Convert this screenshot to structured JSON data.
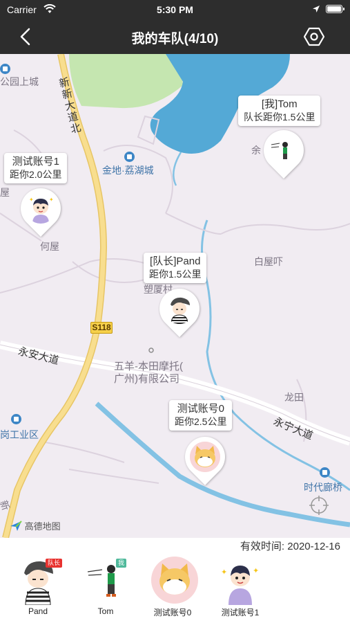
{
  "status_bar": {
    "carrier": "Carrier",
    "time": "5:30 PM"
  },
  "nav": {
    "title": "我的车队(4/10)"
  },
  "map": {
    "place_labels": {
      "park": "公园上城",
      "jindi": "金地·荔湖城",
      "hewu": "何屋",
      "wu": "屋",
      "baiwu": "白屋吓",
      "suliao": "塑厦村",
      "yu": "余",
      "longtian": "龙田",
      "wuyang": "五羊-本田摩托(",
      "wuyang2": "广州)有限公司",
      "gang": "岗工业区",
      "shidai": "时代廊桥",
      "xin": "新"
    },
    "road_labels": {
      "xinxin": "新新大道北",
      "yongan": "永安大道",
      "yongning": "永宁大道",
      "s118": "S118"
    },
    "provider": "高德地图",
    "markers": [
      {
        "line1": "测试账号1",
        "line2": "距你2.0公里"
      },
      {
        "line1": "[我]Tom",
        "line2": "队长距你1.5公里"
      },
      {
        "line1": "[队长]Pand",
        "line2": "距你1.5公里"
      },
      {
        "line1": "测试账号0",
        "line2": "距你2.5公里"
      }
    ]
  },
  "valid_until": "有效时间: 2020-12-16",
  "members": [
    {
      "name": "Pand",
      "badge": "队长"
    },
    {
      "name": "Tom",
      "badge": "我"
    },
    {
      "name": "测试账号0"
    },
    {
      "name": "测试账号1"
    }
  ],
  "colors": {
    "nav_bg": "#2d2d2d",
    "map_bg": "#f1ecf2",
    "water": "#54a9d6",
    "road_main": "#f6d87a",
    "badge_leader": "#e8322f",
    "badge_me": "#4fb99b"
  }
}
